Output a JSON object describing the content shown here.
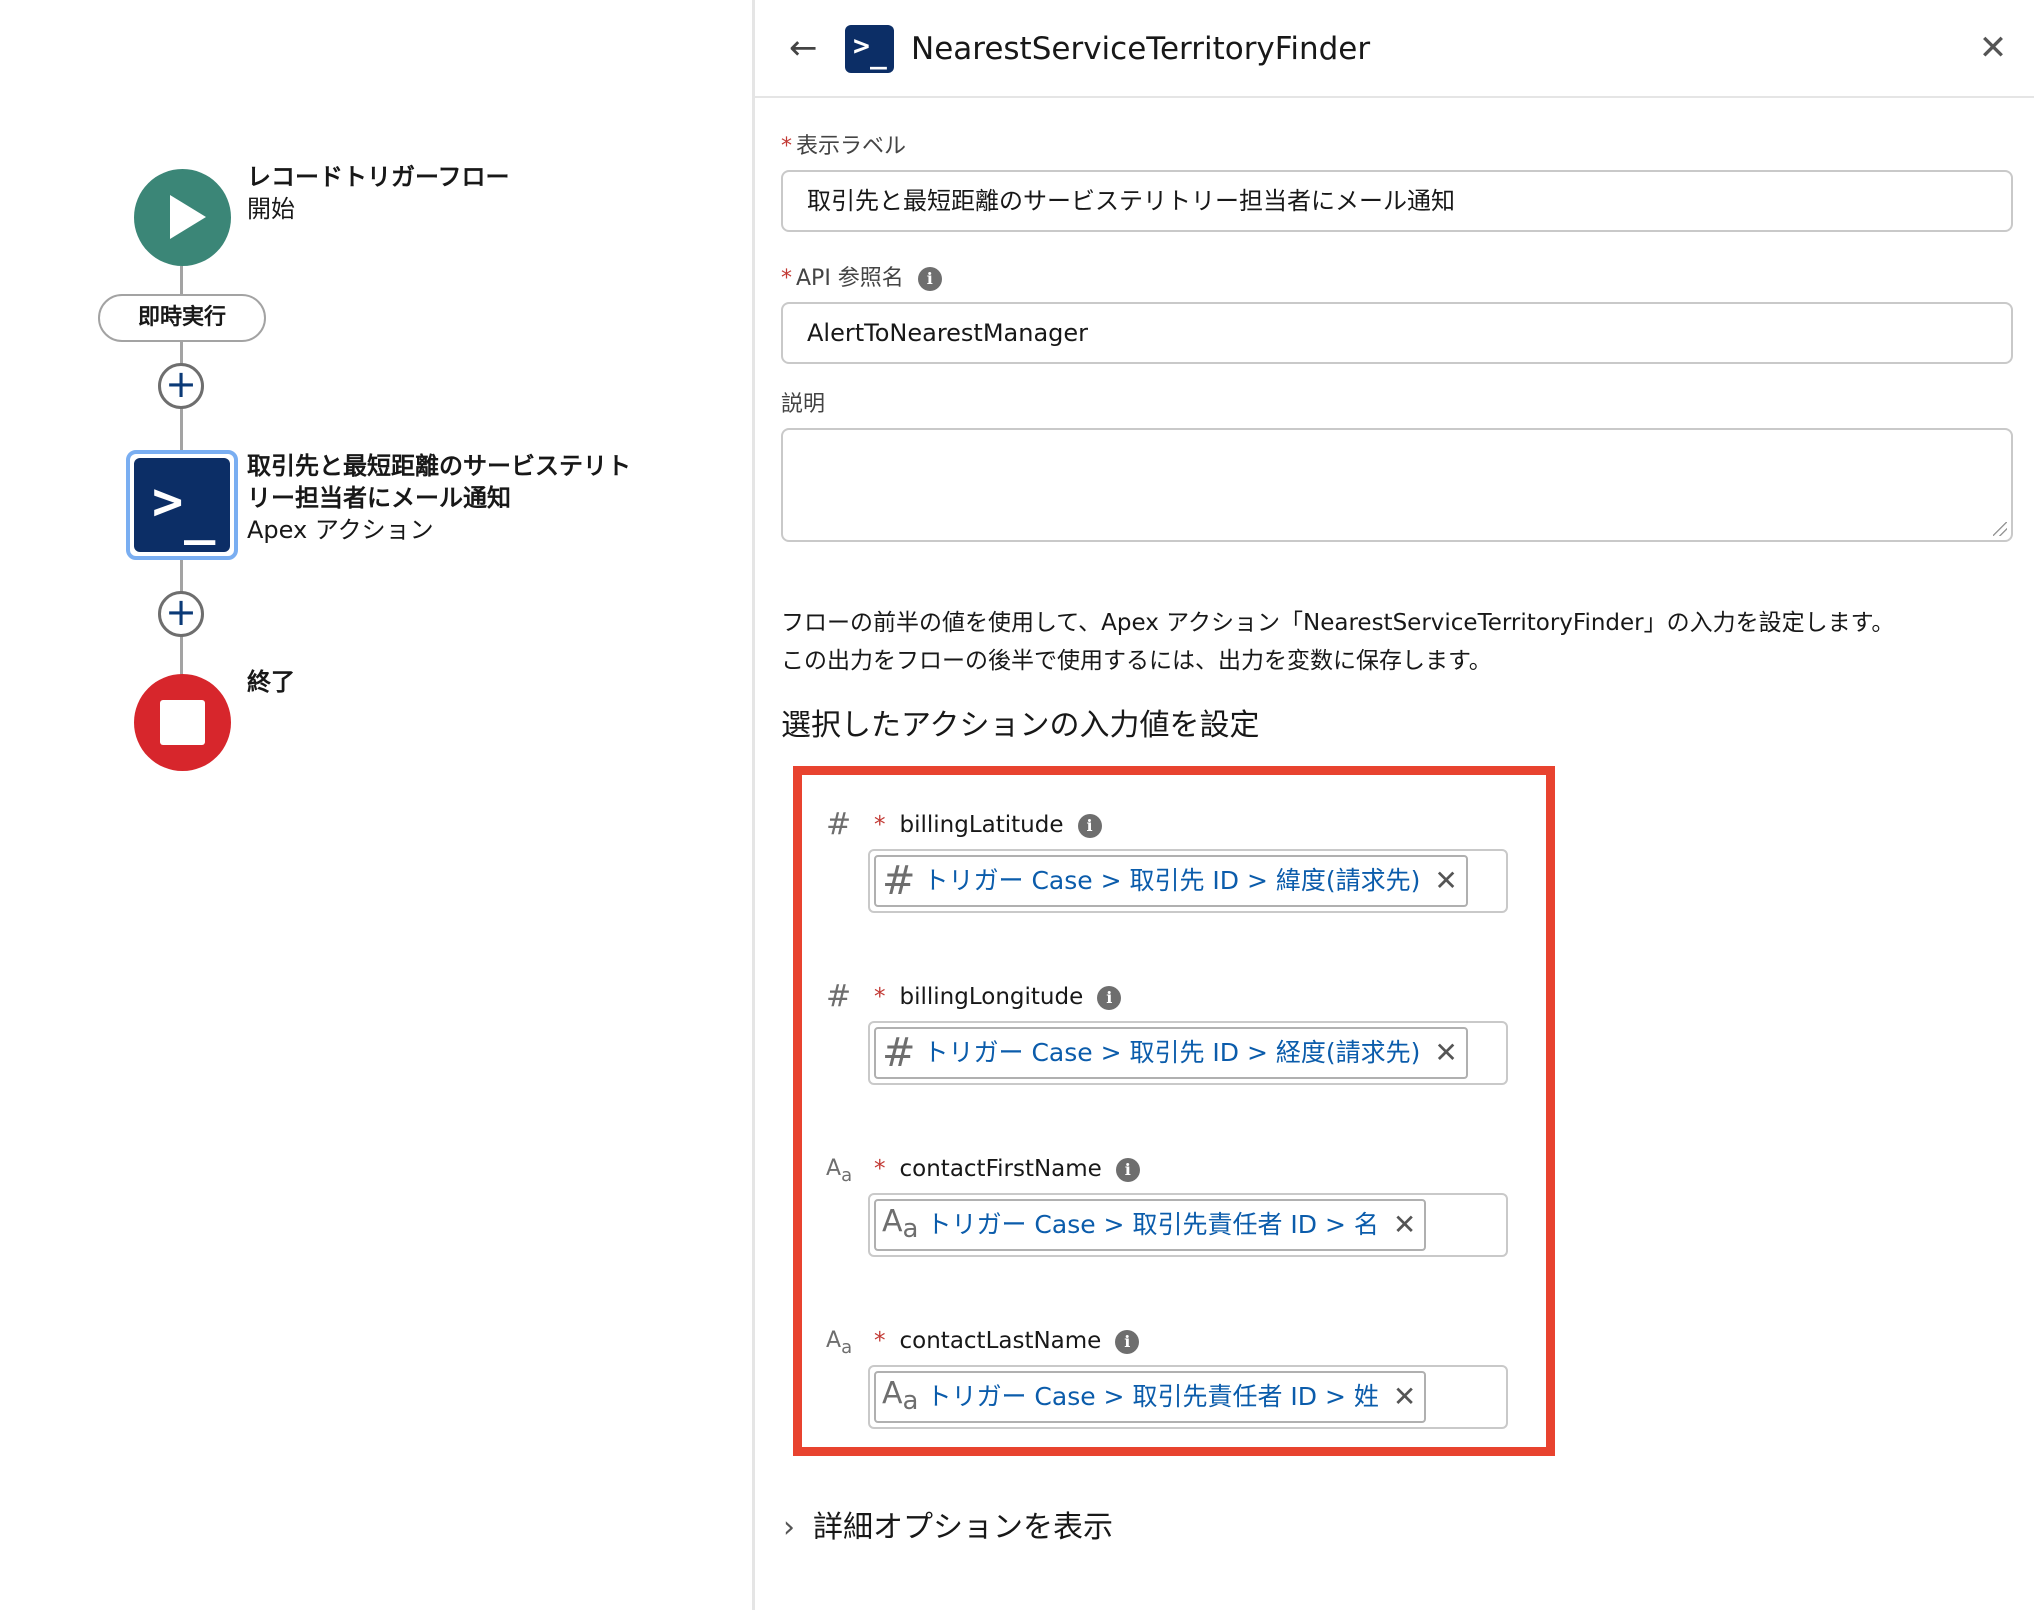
{
  "canvas": {
    "start": {
      "title": "レコードトリガーフロー",
      "subtitle": "開始"
    },
    "immediate_label": "即時実行",
    "add_label": "+",
    "action": {
      "title_line1": "取引先と最短距離のサービステリト",
      "title_line2": "リー担当者にメール通知",
      "subtitle": "Apex アクション"
    },
    "end": {
      "title": "終了"
    }
  },
  "panel": {
    "back_icon": "←",
    "title": "NearestServiceTerritoryFinder",
    "close_icon": "✕",
    "apex_icon_text": ">_",
    "fields": {
      "label": {
        "label": "表示ラベル",
        "value": "取引先と最短距離のサービステリトリー担当者にメール通知"
      },
      "api_name": {
        "label": "API 参照名",
        "value": "AlertToNearestManager"
      },
      "description": {
        "label": "説明",
        "value": ""
      }
    },
    "help_line1": "フローの前半の値を使用して、Apex アクション「NearestServiceTerritoryFinder」の入力を設定します。",
    "help_line2": "この出力をフローの後半で使用するには、出力を変数に保存します。",
    "section_heading": "選択したアクションの入力値を設定",
    "info_glyph": "i",
    "params": [
      {
        "name": "billingLatitude",
        "type": "number",
        "type_glyph": "#",
        "value": "トリガー Case > 取引先 ID > 緯度(請求先)"
      },
      {
        "name": "billingLongitude",
        "type": "number",
        "type_glyph": "#",
        "value": "トリガー Case > 取引先 ID > 経度(請求先)"
      },
      {
        "name": "contactFirstName",
        "type": "text",
        "type_glyph": "A",
        "type_glyph_sub": "a",
        "value": "トリガー Case > 取引先責任者 ID > 名"
      },
      {
        "name": "contactLastName",
        "type": "text",
        "type_glyph": "A",
        "type_glyph_sub": "a",
        "value": "トリガー Case > 取引先責任者 ID > 姓"
      }
    ],
    "remove_icon": "✕",
    "required_mark": "*",
    "advanced_chevron": "›",
    "advanced_label": "詳細オプションを表示"
  },
  "colors": {
    "start": "#3b8677",
    "end": "#d7262c",
    "apex": "#0c2e66",
    "highlight_border": "#e8432f",
    "link": "#0b5cab"
  }
}
